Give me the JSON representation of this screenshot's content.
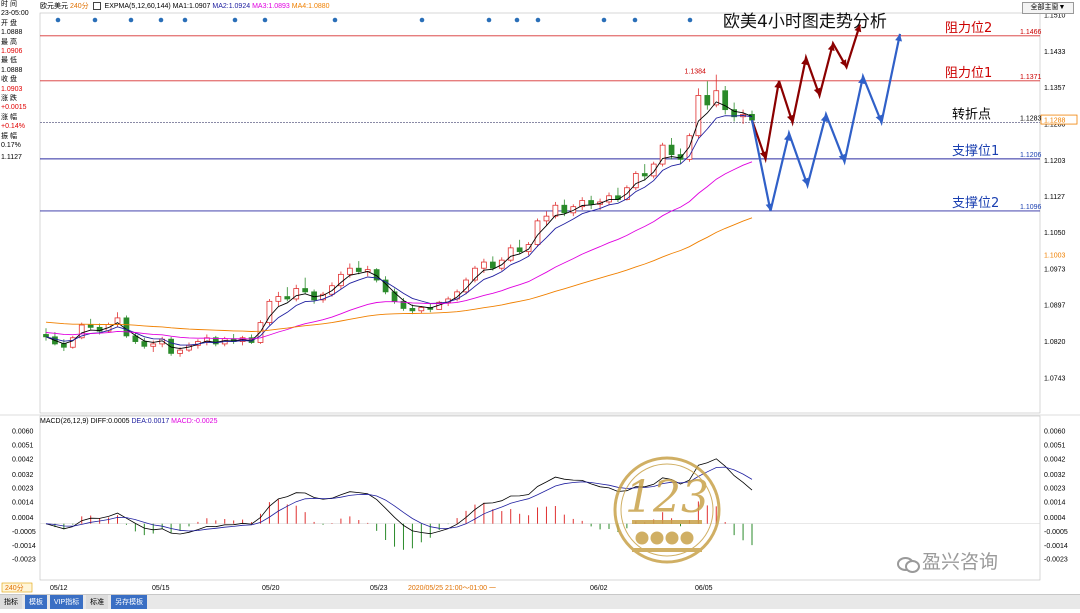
{
  "header": {
    "symbol": "欧元美元",
    "period": "240分",
    "indicator": "EXPMA(5,12,60,144)",
    "ma1": "MA1:1.0907",
    "ma2": "MA2:1.0924",
    "ma3": "MA3:1.0893",
    "ma4": "MA4:1.0880",
    "main_button": "全部主窗▼"
  },
  "side_panel": {
    "time_label": "时 间",
    "time_value": "23-05:00",
    "open_label": "开 盘",
    "open_value": "1.0888",
    "high_label": "最 高",
    "high_value": "1.0906",
    "low_label": "最 低",
    "low_value": "1.0888",
    "close_label": "收 盘",
    "close_value": "1.0903",
    "change_label": "涨 跌",
    "change_value": "+0.0015",
    "pct_label": "涨 幅",
    "pct_value": "+0.14%",
    "amp_label": "振 幅",
    "amp_value": "0.17%",
    "price_mark": "1.1127"
  },
  "title": "欧美4小时图走势分析",
  "levels": [
    {
      "name": "阻力位2",
      "value": 1.1466,
      "label": "1.1466",
      "color": "#cc0000",
      "line": "#d83030"
    },
    {
      "name": "阻力位1",
      "value": 1.1371,
      "label": "1.1371",
      "color": "#cc0000",
      "line": "#d83030"
    },
    {
      "name": "转折点",
      "value": 1.1283,
      "label": "1.1283",
      "color": "#000000",
      "line": "#7a7a9a"
    },
    {
      "name": "支撑位1",
      "value": 1.1206,
      "label": "1.1206",
      "color": "#1a3fb0",
      "line": "#2a2aa0"
    },
    {
      "name": "支撑位2",
      "value": 1.1096,
      "label": "1.1096",
      "color": "#1a3fb0",
      "line": "#2a2aa0"
    }
  ],
  "price_axis": {
    "ticks": [
      "1.1510",
      "1.1433",
      "1.1357",
      "1.1280",
      "1.1203",
      "1.1127",
      "1.1050",
      "1.0973",
      "1.0897",
      "1.0820",
      "1.0743"
    ],
    "current_price": "1.1288",
    "ma_tag": "1.1003",
    "peak_label": "1.1384"
  },
  "time_axis": {
    "labels": [
      "05/12",
      "05/15",
      "05/20",
      "05/23",
      "06/02",
      "06/05"
    ],
    "cursor_label": "2020/05/25 21:00～01:00 一",
    "period_tag": "240分"
  },
  "macd": {
    "legend_name": "MACD(26,12,9)",
    "diff": "DIFF:0.0005",
    "dea": "DEA:0.0017",
    "macd": "MACD:-0.0025",
    "ticks": [
      "0.0060",
      "0.0051",
      "0.0042",
      "0.0032",
      "0.0023",
      "0.0014",
      "0.0004",
      "-0.0005",
      "-0.0014",
      "-0.0023"
    ]
  },
  "bottom_tabs": [
    "指标",
    "模板",
    "VIP指标",
    "标准",
    "另存模板"
  ],
  "brand": "盈兴咨询",
  "logo_text": "123",
  "colors": {
    "up": "#e03030",
    "down": "#2a8a2a",
    "ma_short": "#000000",
    "ma_mid": "#2020a0",
    "ma_60": "#e000e0",
    "ma_144": "#f08000",
    "forecast_red": "#8b0000",
    "forecast_blue": "#3060c8"
  },
  "chart_data": {
    "type": "candlestick",
    "title": "欧美4小时图走势分析",
    "price_ylim": [
      1.0743,
      1.151
    ],
    "candles": [
      [
        1.0835,
        1.0848,
        1.0822,
        1.083
      ],
      [
        1.083,
        1.084,
        1.0812,
        1.0815
      ],
      [
        1.0815,
        1.0825,
        1.08,
        1.0808
      ],
      [
        1.0808,
        1.0832,
        1.0805,
        1.0828
      ],
      [
        1.0828,
        1.086,
        1.0825,
        1.0855
      ],
      [
        1.0855,
        1.0868,
        1.0845,
        1.085
      ],
      [
        1.085,
        1.0858,
        1.0835,
        1.0842
      ],
      [
        1.0842,
        1.086,
        1.0838,
        1.0856
      ],
      [
        1.0856,
        1.0882,
        1.085,
        1.087
      ],
      [
        1.087,
        1.0875,
        1.0828,
        1.0832
      ],
      [
        1.0832,
        1.084,
        1.0815,
        1.082
      ],
      [
        1.082,
        1.0828,
        1.0805,
        1.081
      ],
      [
        1.081,
        1.0822,
        1.0798,
        1.0815
      ],
      [
        1.0815,
        1.083,
        1.0808,
        1.0825
      ],
      [
        1.0825,
        1.083,
        1.079,
        1.0795
      ],
      [
        1.0795,
        1.0808,
        1.0788,
        1.0802
      ],
      [
        1.0802,
        1.0818,
        1.0798,
        1.0812
      ],
      [
        1.0812,
        1.0825,
        1.0805,
        1.082
      ],
      [
        1.082,
        1.0835,
        1.0812,
        1.0828
      ],
      [
        1.0828,
        1.0832,
        1.081,
        1.0815
      ],
      [
        1.0815,
        1.083,
        1.081,
        1.0826
      ],
      [
        1.0826,
        1.0836,
        1.0815,
        1.082
      ],
      [
        1.082,
        1.0832,
        1.0812,
        1.0828
      ],
      [
        1.0828,
        1.0835,
        1.0815,
        1.0818
      ],
      [
        1.0818,
        1.0865,
        1.0815,
        1.086
      ],
      [
        1.086,
        1.091,
        1.0855,
        1.0905
      ],
      [
        1.0905,
        1.0925,
        1.0895,
        1.0915
      ],
      [
        1.0915,
        1.0935,
        1.0905,
        1.091
      ],
      [
        1.091,
        1.094,
        1.0905,
        1.0932
      ],
      [
        1.0932,
        1.0955,
        1.092,
        1.0925
      ],
      [
        1.0925,
        1.093,
        1.09,
        1.0908
      ],
      [
        1.0908,
        1.0925,
        1.0902,
        1.092
      ],
      [
        1.092,
        1.0945,
        1.0915,
        1.0938
      ],
      [
        1.0938,
        1.0968,
        1.093,
        1.0962
      ],
      [
        1.0962,
        1.0985,
        1.0955,
        1.0975
      ],
      [
        1.0975,
        1.099,
        1.0962,
        1.0968
      ],
      [
        1.0968,
        1.098,
        1.0958,
        1.0972
      ],
      [
        1.0972,
        1.0975,
        1.0945,
        1.095
      ],
      [
        1.095,
        1.0958,
        1.092,
        1.0925
      ],
      [
        1.0925,
        1.0932,
        1.09,
        1.0905
      ],
      [
        1.0905,
        1.0912,
        1.0885,
        1.089
      ],
      [
        1.089,
        1.0898,
        1.0878,
        1.0885
      ],
      [
        1.0885,
        1.0895,
        1.088,
        1.0892
      ],
      [
        1.0892,
        1.09,
        1.0882,
        1.0888
      ],
      [
        1.0888,
        1.0906,
        1.0888,
        1.0903
      ],
      [
        1.0903,
        1.0915,
        1.0895,
        1.091
      ],
      [
        1.091,
        1.093,
        1.0905,
        1.0925
      ],
      [
        1.0925,
        1.0955,
        1.092,
        1.095
      ],
      [
        1.095,
        1.098,
        1.0945,
        1.0975
      ],
      [
        1.0975,
        1.0995,
        1.0965,
        1.0988
      ],
      [
        1.0988,
        1.1,
        1.097,
        1.0975
      ],
      [
        1.0975,
        1.0998,
        1.097,
        1.0992
      ],
      [
        1.0992,
        1.1025,
        1.0988,
        1.1018
      ],
      [
        1.1018,
        1.1035,
        1.1005,
        1.101
      ],
      [
        1.101,
        1.103,
        1.1002,
        1.1025
      ],
      [
        1.1025,
        1.108,
        1.102,
        1.1075
      ],
      [
        1.1075,
        1.1095,
        1.1065,
        1.1085
      ],
      [
        1.1085,
        1.1115,
        1.108,
        1.1108
      ],
      [
        1.1108,
        1.112,
        1.1085,
        1.1092
      ],
      [
        1.1092,
        1.111,
        1.1085,
        1.1105
      ],
      [
        1.1105,
        1.1125,
        1.1098,
        1.1118
      ],
      [
        1.1118,
        1.1128,
        1.11,
        1.111
      ],
      [
        1.111,
        1.1122,
        1.1098,
        1.1115
      ],
      [
        1.1115,
        1.1135,
        1.1108,
        1.1128
      ],
      [
        1.1128,
        1.1145,
        1.1115,
        1.112
      ],
      [
        1.112,
        1.115,
        1.1118,
        1.1145
      ],
      [
        1.1145,
        1.118,
        1.114,
        1.1175
      ],
      [
        1.1175,
        1.1195,
        1.116,
        1.117
      ],
      [
        1.117,
        1.12,
        1.1165,
        1.1195
      ],
      [
        1.1195,
        1.124,
        1.119,
        1.1235
      ],
      [
        1.1235,
        1.125,
        1.1205,
        1.1215
      ],
      [
        1.1215,
        1.1228,
        1.1195,
        1.1205
      ],
      [
        1.1205,
        1.126,
        1.12,
        1.1255
      ],
      [
        1.1255,
        1.1355,
        1.125,
        1.134
      ],
      [
        1.134,
        1.137,
        1.131,
        1.132
      ],
      [
        1.132,
        1.1384,
        1.1315,
        1.135
      ],
      [
        1.135,
        1.136,
        1.13,
        1.131
      ],
      [
        1.131,
        1.1325,
        1.1285,
        1.1295
      ],
      [
        1.1295,
        1.131,
        1.128,
        1.13
      ],
      [
        1.13,
        1.1308,
        1.1282,
        1.1288
      ]
    ],
    "forecast_red": [
      1.1288,
      1.1206,
      1.1371,
      1.1283,
      1.142,
      1.134,
      1.145,
      1.14,
      1.149
    ],
    "forecast_blue": [
      1.1288,
      1.1096,
      1.126,
      1.115,
      1.13,
      1.12,
      1.138,
      1.1283,
      1.147
    ],
    "macd_ylim": [
      -0.003,
      0.0062
    ]
  }
}
